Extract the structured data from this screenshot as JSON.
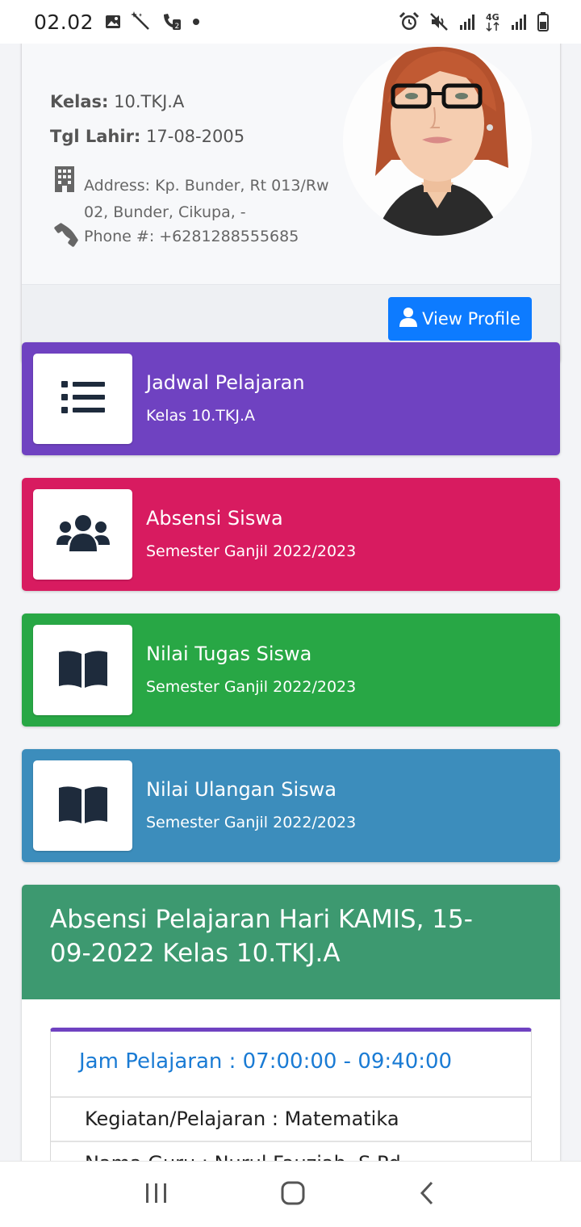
{
  "status_bar": {
    "time": "02.02",
    "network": "4G"
  },
  "profile": {
    "kelas_label": "Kelas:",
    "kelas_value": "10.TKJ.A",
    "tgl_label": "Tgl Lahir:",
    "tgl_value": "17-08-2005",
    "address": "Address: Kp. Bunder, Rt 013/Rw 02, Bunder, Cikupa, -",
    "phone": "Phone #: +6281288555685",
    "view_profile_label": "View Profile",
    "button_color": "#0d7bff"
  },
  "menu": [
    {
      "title": "Jadwal Pelajaran",
      "subtitle": "Kelas 10.TKJ.A",
      "icon": "list-icon",
      "color": "#6f42c1"
    },
    {
      "title": "Absensi Siswa",
      "subtitle": "Semester Ganjil 2022/2023",
      "icon": "users-icon",
      "color": "#d81b60"
    },
    {
      "title": "Nilai Tugas Siswa",
      "subtitle": "Semester Ganjil 2022/2023",
      "icon": "book-open-icon",
      "color": "#28a745"
    },
    {
      "title": "Nilai Ulangan Siswa",
      "subtitle": "Semester Ganjil 2022/2023",
      "icon": "book-open-icon",
      "color": "#3c8dbc"
    }
  ],
  "attendance": {
    "header": "Absensi Pelajaran Hari KAMIS, 15-09-2022 Kelas 10.TKJ.A",
    "header_color": "#3d9970",
    "jam": "Jam Pelajaran : 07:00:00 - 09:40:00",
    "kegiatan": "Kegiatan/Pelajaran : Matematika",
    "guru_partial": "Nama Guru : Nurul Fauziah, S.Pd"
  },
  "navbar": {
    "recent_icon": "recent-apps-icon",
    "home_icon": "home-icon",
    "back_icon": "back-icon"
  }
}
